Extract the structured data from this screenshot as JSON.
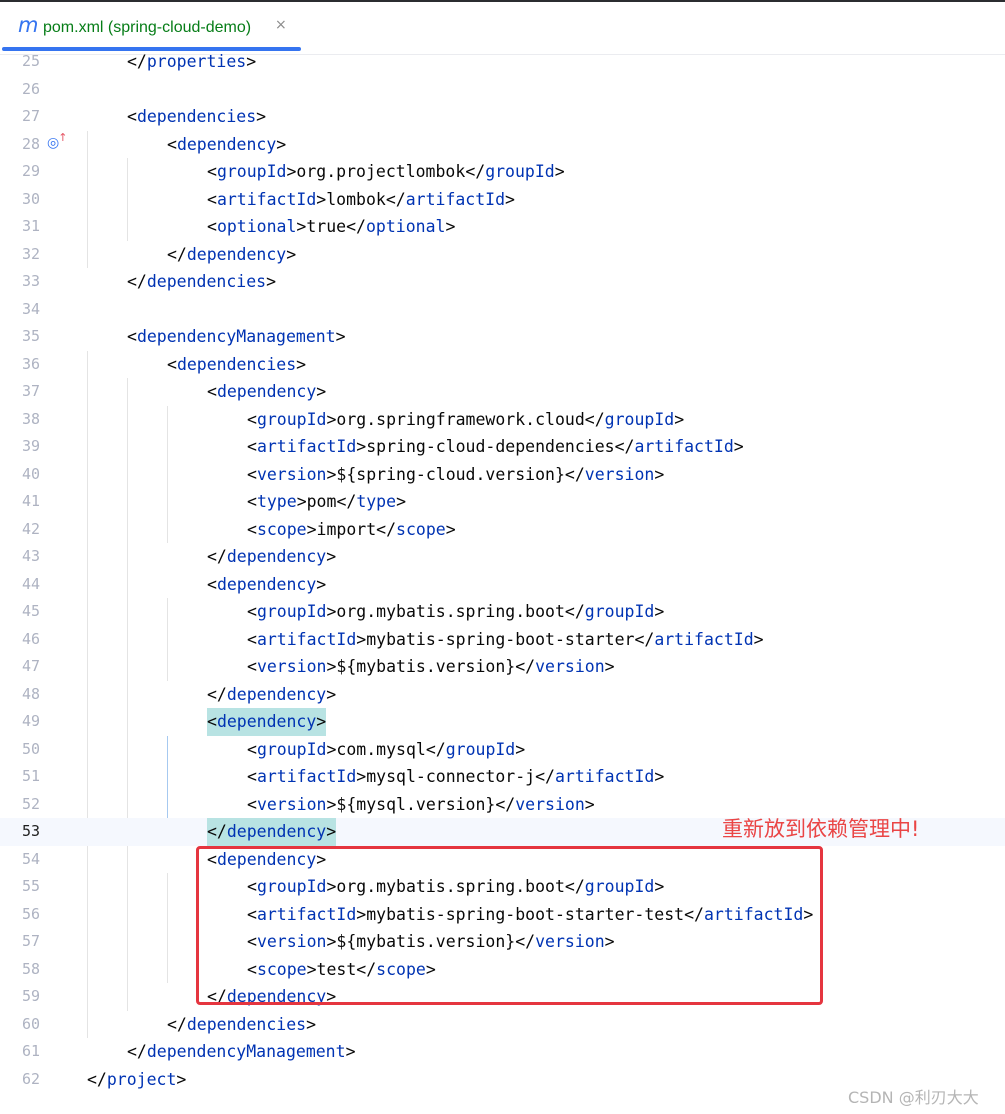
{
  "tab": {
    "icon": "maven-m-icon",
    "icon_glyph": "m",
    "label": "pom.xml (spring-cloud-demo)",
    "close_glyph": "×"
  },
  "annotation": "重新放到依赖管理中!",
  "watermark": "CSDN @利刃大大",
  "current_line": 53,
  "lines": [
    {
      "n": 25,
      "indent": 1,
      "parts": [
        [
          "p",
          "</"
        ],
        [
          "tg",
          "properties"
        ],
        [
          "p",
          ">"
        ]
      ]
    },
    {
      "n": 26,
      "indent": 0,
      "parts": []
    },
    {
      "n": 27,
      "indent": 1,
      "parts": [
        [
          "p",
          "<"
        ],
        [
          "tg",
          "dependencies"
        ],
        [
          "p",
          ">"
        ]
      ]
    },
    {
      "n": 28,
      "indent": 2,
      "parts": [
        [
          "p",
          "<"
        ],
        [
          "tg",
          "dependency"
        ],
        [
          "p",
          ">"
        ]
      ]
    },
    {
      "n": 29,
      "indent": 3,
      "parts": [
        [
          "p",
          "<"
        ],
        [
          "tg",
          "groupId"
        ],
        [
          "p",
          ">"
        ],
        [
          "tx",
          "org.projectlombok"
        ],
        [
          "p",
          "</"
        ],
        [
          "tg",
          "groupId"
        ],
        [
          "p",
          ">"
        ]
      ]
    },
    {
      "n": 30,
      "indent": 3,
      "parts": [
        [
          "p",
          "<"
        ],
        [
          "tg",
          "artifactId"
        ],
        [
          "p",
          ">"
        ],
        [
          "tx",
          "lombok"
        ],
        [
          "p",
          "</"
        ],
        [
          "tg",
          "artifactId"
        ],
        [
          "p",
          ">"
        ]
      ]
    },
    {
      "n": 31,
      "indent": 3,
      "parts": [
        [
          "p",
          "<"
        ],
        [
          "tg",
          "optional"
        ],
        [
          "p",
          ">"
        ],
        [
          "tx",
          "true"
        ],
        [
          "p",
          "</"
        ],
        [
          "tg",
          "optional"
        ],
        [
          "p",
          ">"
        ]
      ]
    },
    {
      "n": 32,
      "indent": 2,
      "parts": [
        [
          "p",
          "</"
        ],
        [
          "tg",
          "dependency"
        ],
        [
          "p",
          ">"
        ]
      ]
    },
    {
      "n": 33,
      "indent": 1,
      "parts": [
        [
          "p",
          "</"
        ],
        [
          "tg",
          "dependencies"
        ],
        [
          "p",
          ">"
        ]
      ]
    },
    {
      "n": 34,
      "indent": 0,
      "parts": []
    },
    {
      "n": 35,
      "indent": 1,
      "parts": [
        [
          "p",
          "<"
        ],
        [
          "tg",
          "dependencyManagement"
        ],
        [
          "p",
          ">"
        ]
      ]
    },
    {
      "n": 36,
      "indent": 2,
      "parts": [
        [
          "p",
          "<"
        ],
        [
          "tg",
          "dependencies"
        ],
        [
          "p",
          ">"
        ]
      ]
    },
    {
      "n": 37,
      "indent": 3,
      "parts": [
        [
          "p",
          "<"
        ],
        [
          "tg",
          "dependency"
        ],
        [
          "p",
          ">"
        ]
      ]
    },
    {
      "n": 38,
      "indent": 4,
      "parts": [
        [
          "p",
          "<"
        ],
        [
          "tg",
          "groupId"
        ],
        [
          "p",
          ">"
        ],
        [
          "tx",
          "org.springframework.cloud"
        ],
        [
          "p",
          "</"
        ],
        [
          "tg",
          "groupId"
        ],
        [
          "p",
          ">"
        ]
      ]
    },
    {
      "n": 39,
      "indent": 4,
      "parts": [
        [
          "p",
          "<"
        ],
        [
          "tg",
          "artifactId"
        ],
        [
          "p",
          ">"
        ],
        [
          "tx",
          "spring-cloud-dependencies"
        ],
        [
          "p",
          "</"
        ],
        [
          "tg",
          "artifactId"
        ],
        [
          "p",
          ">"
        ]
      ]
    },
    {
      "n": 40,
      "indent": 4,
      "parts": [
        [
          "p",
          "<"
        ],
        [
          "tg",
          "version"
        ],
        [
          "p",
          ">"
        ],
        [
          "tx",
          "${spring-cloud.version}"
        ],
        [
          "p",
          "</"
        ],
        [
          "tg",
          "version"
        ],
        [
          "p",
          ">"
        ]
      ]
    },
    {
      "n": 41,
      "indent": 4,
      "parts": [
        [
          "p",
          "<"
        ],
        [
          "tg",
          "type"
        ],
        [
          "p",
          ">"
        ],
        [
          "tx",
          "pom"
        ],
        [
          "p",
          "</"
        ],
        [
          "tg",
          "type"
        ],
        [
          "p",
          ">"
        ]
      ]
    },
    {
      "n": 42,
      "indent": 4,
      "parts": [
        [
          "p",
          "<"
        ],
        [
          "tg",
          "scope"
        ],
        [
          "p",
          ">"
        ],
        [
          "tx",
          "import"
        ],
        [
          "p",
          "</"
        ],
        [
          "tg",
          "scope"
        ],
        [
          "p",
          ">"
        ]
      ]
    },
    {
      "n": 43,
      "indent": 3,
      "parts": [
        [
          "p",
          "</"
        ],
        [
          "tg",
          "dependency"
        ],
        [
          "p",
          ">"
        ]
      ]
    },
    {
      "n": 44,
      "indent": 3,
      "parts": [
        [
          "p",
          "<"
        ],
        [
          "tg",
          "dependency"
        ],
        [
          "p",
          ">"
        ]
      ]
    },
    {
      "n": 45,
      "indent": 4,
      "parts": [
        [
          "p",
          "<"
        ],
        [
          "tg",
          "groupId"
        ],
        [
          "p",
          ">"
        ],
        [
          "tx",
          "org.mybatis.spring.boot"
        ],
        [
          "p",
          "</"
        ],
        [
          "tg",
          "groupId"
        ],
        [
          "p",
          ">"
        ]
      ]
    },
    {
      "n": 46,
      "indent": 4,
      "parts": [
        [
          "p",
          "<"
        ],
        [
          "tg",
          "artifactId"
        ],
        [
          "p",
          ">"
        ],
        [
          "tx",
          "mybatis-spring-boot-starter"
        ],
        [
          "p",
          "</"
        ],
        [
          "tg",
          "artifactId"
        ],
        [
          "p",
          ">"
        ]
      ]
    },
    {
      "n": 47,
      "indent": 4,
      "parts": [
        [
          "p",
          "<"
        ],
        [
          "tg",
          "version"
        ],
        [
          "p",
          ">"
        ],
        [
          "tx",
          "${mybatis.version}"
        ],
        [
          "p",
          "</"
        ],
        [
          "tg",
          "version"
        ],
        [
          "p",
          ">"
        ]
      ]
    },
    {
      "n": 48,
      "indent": 3,
      "parts": [
        [
          "p",
          "</"
        ],
        [
          "tg",
          "dependency"
        ],
        [
          "p",
          ">"
        ]
      ]
    },
    {
      "n": 49,
      "indent": 3,
      "hl": true,
      "parts": [
        [
          "p",
          "<"
        ],
        [
          "tg",
          "dependency"
        ],
        [
          "p",
          ">"
        ]
      ]
    },
    {
      "n": 50,
      "indent": 4,
      "parts": [
        [
          "p",
          "<"
        ],
        [
          "tg",
          "groupId"
        ],
        [
          "p",
          ">"
        ],
        [
          "tx",
          "com.mysql"
        ],
        [
          "p",
          "</"
        ],
        [
          "tg",
          "groupId"
        ],
        [
          "p",
          ">"
        ]
      ]
    },
    {
      "n": 51,
      "indent": 4,
      "parts": [
        [
          "p",
          "<"
        ],
        [
          "tg",
          "artifactId"
        ],
        [
          "p",
          ">"
        ],
        [
          "tx",
          "mysql-connector-j"
        ],
        [
          "p",
          "</"
        ],
        [
          "tg",
          "artifactId"
        ],
        [
          "p",
          ">"
        ]
      ]
    },
    {
      "n": 52,
      "indent": 4,
      "parts": [
        [
          "p",
          "<"
        ],
        [
          "tg",
          "version"
        ],
        [
          "p",
          ">"
        ],
        [
          "tx",
          "${mysql.version}"
        ],
        [
          "p",
          "</"
        ],
        [
          "tg",
          "version"
        ],
        [
          "p",
          ">"
        ]
      ]
    },
    {
      "n": 53,
      "indent": 3,
      "hl": true,
      "parts": [
        [
          "p",
          "</"
        ],
        [
          "tg",
          "dependency"
        ],
        [
          "p",
          ">"
        ]
      ]
    },
    {
      "n": 54,
      "indent": 3,
      "parts": [
        [
          "p",
          "<"
        ],
        [
          "tg",
          "dependency"
        ],
        [
          "p",
          ">"
        ]
      ]
    },
    {
      "n": 55,
      "indent": 4,
      "parts": [
        [
          "p",
          "<"
        ],
        [
          "tg",
          "groupId"
        ],
        [
          "p",
          ">"
        ],
        [
          "tx",
          "org.mybatis.spring.boot"
        ],
        [
          "p",
          "</"
        ],
        [
          "tg",
          "groupId"
        ],
        [
          "p",
          ">"
        ]
      ]
    },
    {
      "n": 56,
      "indent": 4,
      "parts": [
        [
          "p",
          "<"
        ],
        [
          "tg",
          "artifactId"
        ],
        [
          "p",
          ">"
        ],
        [
          "tx",
          "mybatis-spring-boot-starter-test"
        ],
        [
          "p",
          "</"
        ],
        [
          "tg",
          "artifactId"
        ],
        [
          "p",
          ">"
        ]
      ]
    },
    {
      "n": 57,
      "indent": 4,
      "parts": [
        [
          "p",
          "<"
        ],
        [
          "tg",
          "version"
        ],
        [
          "p",
          ">"
        ],
        [
          "tx",
          "${mybatis.version}"
        ],
        [
          "p",
          "</"
        ],
        [
          "tg",
          "version"
        ],
        [
          "p",
          ">"
        ]
      ]
    },
    {
      "n": 58,
      "indent": 4,
      "parts": [
        [
          "p",
          "<"
        ],
        [
          "tg",
          "scope"
        ],
        [
          "p",
          ">"
        ],
        [
          "tx",
          "test"
        ],
        [
          "p",
          "</"
        ],
        [
          "tg",
          "scope"
        ],
        [
          "p",
          ">"
        ]
      ]
    },
    {
      "n": 59,
      "indent": 3,
      "parts": [
        [
          "p",
          "</"
        ],
        [
          "tg",
          "dependency"
        ],
        [
          "p",
          ">"
        ]
      ]
    },
    {
      "n": 60,
      "indent": 2,
      "parts": [
        [
          "p",
          "</"
        ],
        [
          "tg",
          "dependencies"
        ],
        [
          "p",
          ">"
        ]
      ]
    },
    {
      "n": 61,
      "indent": 1,
      "parts": [
        [
          "p",
          "</"
        ],
        [
          "tg",
          "dependencyManagement"
        ],
        [
          "p",
          ">"
        ]
      ]
    },
    {
      "n": 62,
      "indent": 0,
      "parts": [
        [
          "p",
          "</"
        ],
        [
          "tg",
          "project"
        ],
        [
          "p",
          ">"
        ]
      ]
    }
  ]
}
